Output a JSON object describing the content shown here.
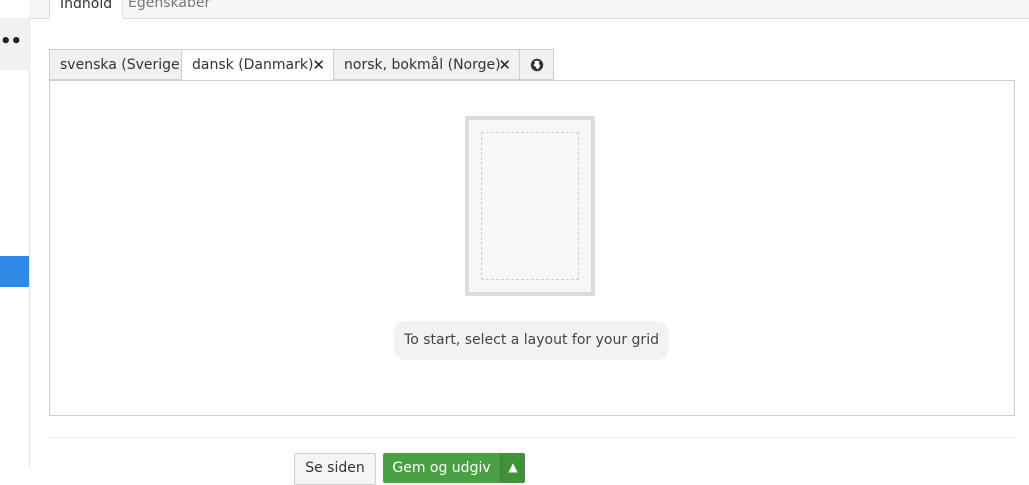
{
  "rail": {
    "menu_icon": "more-dots-icon"
  },
  "top_tabs": {
    "content": "Indhold",
    "properties": "Egenskaber"
  },
  "language_tabs": {
    "sv": "svenska (Sverige)",
    "da": "dansk (Danmark)",
    "no": "norsk, bokmål (Norge)",
    "close_symbol": "✕",
    "globe_icon": "globe-icon"
  },
  "grid": {
    "hint": "To start, select a layout for your grid"
  },
  "footer": {
    "see_page": "Se siden",
    "save_publish": "Gem og udgiv",
    "caret": "▲"
  },
  "colors": {
    "accent_blue": "#2e8ae6",
    "publish_green": "#4aa042"
  }
}
